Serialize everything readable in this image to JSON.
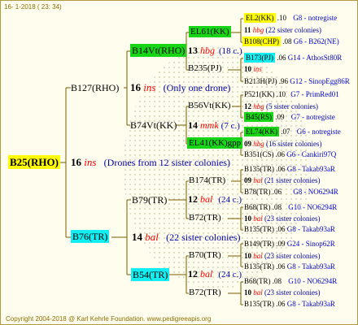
{
  "header": {
    "date": "16-  1-2018 ( 23: 34)"
  },
  "footer": {
    "copyright": "Copyright 2004-2018 @ Karl Kehrle Foundation.   www.pedigreeapis.org"
  },
  "colors": {
    "green": "#16d616",
    "yellow": "#ffff00",
    "cyan": "#12eef2",
    "line": "#7a5c00",
    "red": "#ff0000",
    "blue": "#0000aa"
  },
  "root": {
    "name": "B25(RHO)",
    "gen_num": "16",
    "gen_ins": "ins",
    "desc": "(Drones from 12 sister colonies)"
  },
  "g1": {
    "b127": {
      "name": "B127(RHO)",
      "num": "16",
      "ins": "ins",
      "desc": "(Only one drone)"
    },
    "b76": {
      "name": "B76(TR)",
      "num": "14",
      "ins": "bal",
      "desc": "(22 sister colonies)"
    }
  },
  "g2": {
    "b14": {
      "name": "B14Vt(RHO)",
      "num": "13",
      "ins": "hbg",
      "desc": "(18 c.)"
    },
    "b74": {
      "name": "B74Vt(KK)",
      "num": "14",
      "ins": "mmk",
      "desc": "(7 c.)"
    },
    "b79": {
      "name": "B79(TR)",
      "num": "12",
      "ins": "bal",
      "desc": "(24 c.)"
    },
    "b54": {
      "name": "B54(TR)",
      "num": "12",
      "ins": "bal",
      "desc": "(24 c.)"
    }
  },
  "g3": {
    "el61": {
      "name": "EL61(KK)",
      "num": "11",
      "ins": "hbg",
      "desc": "(22 sister colonies)"
    },
    "b235": {
      "name": "B235(PJ)",
      "num": "10",
      "ins": "ins"
    },
    "b56": {
      "name": "B56Vt(KK)",
      "num": "12",
      "ins": "hbg",
      "desc": "(5 sister colonies)"
    },
    "el41": {
      "name": "EL41(KK)gpp",
      "num": "09",
      "ins": "hbg",
      "desc": "(16 sister colonies)"
    },
    "b174": {
      "name": "B174(TR)",
      "num": "09",
      "ins": "bal",
      "desc": "(21 sister colonies)"
    },
    "b72a": {
      "name": "B72(TR)",
      "num": "10",
      "ins": "bal",
      "desc": "(23 sister colonies)"
    },
    "b70": {
      "name": "B70(TR)",
      "num": "10",
      "ins": "bal",
      "desc": "(23 sister colonies)"
    },
    "b72b": {
      "name": "B72(TR)",
      "num": "10",
      "ins": "bal",
      "desc": "(23 sister colonies)"
    }
  },
  "g4": [
    {
      "name": "EL2(KK)",
      "val": ".10",
      "note": "G8 - notregiste"
    },
    {
      "name": "B108(CHP)",
      "val": ".08",
      "note": "G6 - B262(NE)"
    },
    {
      "name": "B173(PJ)",
      "val": ".06",
      "note": "G14 - AthosSt80R"
    },
    {
      "name": "B213H(PJ)",
      "val": ".96",
      "note": "G12 - SinopEgg86R"
    },
    {
      "name": "P521(KK)",
      "val": ".10",
      "note": "G7 - PrimRed01"
    },
    {
      "name": "B45(RS)",
      "val": ".09",
      "note": "G7 - notregiste"
    },
    {
      "name": "EL74(KK)",
      "val": ".07",
      "note": "G6 - notregiste"
    },
    {
      "name": "B351(CS)",
      "val": ".06",
      "note": "G6 - Cankiri97Q"
    },
    {
      "name": "B135(TR)",
      "val": ".06",
      "note": "G8 - Takab93aR"
    },
    {
      "name": "B78(TR)",
      "val": ".06",
      "note": "G8 - NO6294R"
    },
    {
      "name": "B68(TR)",
      "val": ".08",
      "note": "G10 - NO6294R"
    },
    {
      "name": "B135(TR)",
      "val": ".06",
      "note": "G8 - Takab93aR"
    },
    {
      "name": "B149(TR)",
      "val": ".09",
      "note": "G24 - Sinop62R"
    },
    {
      "name": "B135(TR)",
      "val": ".06",
      "note": "G8 - Takab93aR"
    },
    {
      "name": "B68(TR)",
      "val": ".08",
      "note": "G10 - NO6294R"
    },
    {
      "name": "B135(TR)",
      "val": ".06",
      "note": "G8 - Takab93aR"
    }
  ]
}
